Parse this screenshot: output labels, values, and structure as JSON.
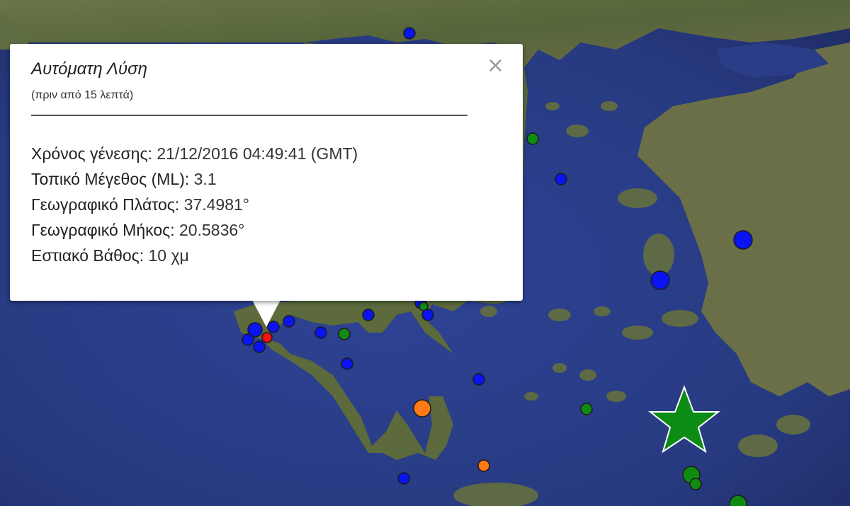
{
  "info_window": {
    "title": "Αυτόματη Λύση",
    "subtitle": "(πριν από 15 λεπτά)",
    "close_symbol": "×",
    "rows": [
      {
        "label": "Χρόνος γένεσης: ",
        "value": "21/12/2016  04:49:41 (GMT)"
      },
      {
        "label": "Τοπικό Μέγεθος (ML): ",
        "value": "3.1"
      },
      {
        "label": "Γεωγραφικό Πλάτος: ",
        "value": "37.4981°"
      },
      {
        "label": "Γεωγραφικό Μήκος: ",
        "value": "20.5836°"
      },
      {
        "label": "Εστιακό Βάθος: ",
        "value": "10 χμ"
      }
    ]
  },
  "map": {
    "type": "satellite",
    "colors": {
      "sea": "#2b3d86",
      "land": "#5a6b3e",
      "blue_marker": "#0a14f0",
      "green_marker": "#118a11",
      "orange_marker": "#ff7a14",
      "red_marker": "#ff1010",
      "star": "#0c8c14"
    }
  }
}
